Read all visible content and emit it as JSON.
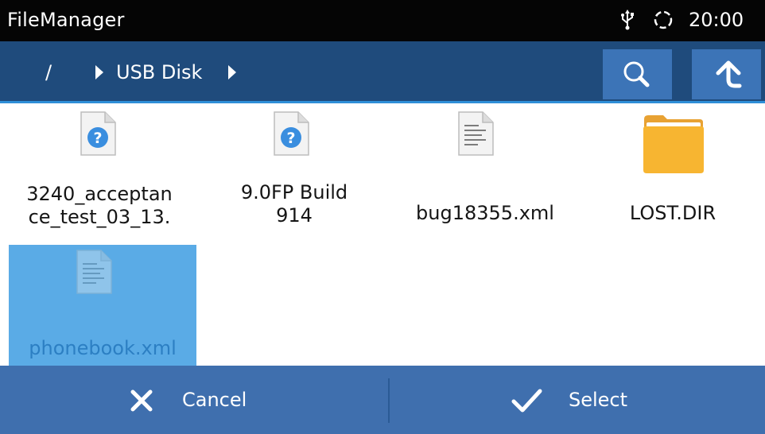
{
  "status_bar": {
    "app_title": "FileManager",
    "usb_icon": "usb-icon",
    "sync_icon": "sync-icon",
    "time": "20:00"
  },
  "path_bar": {
    "breadcrumbs": [
      "/",
      "USB Disk"
    ],
    "search_icon": "search-icon",
    "up_icon": "up-arrow-icon",
    "background_color": "#1f4b7c",
    "button_color": "#3c74b7"
  },
  "files": [
    {
      "name_line1": "3240_acceptan",
      "name_line2": "ce_test_03_13.",
      "icon": "unknown-file-icon",
      "selected": false
    },
    {
      "name_line1": "9.0FP Build",
      "name_line2": "914",
      "icon": "unknown-file-icon",
      "selected": false
    },
    {
      "name": "bug18355.xml",
      "icon": "text-file-icon",
      "selected": false
    },
    {
      "name": "LOST.DIR",
      "icon": "folder-icon",
      "selected": false
    },
    {
      "name": "phonebook.xml",
      "icon": "text-file-icon",
      "selected": true
    }
  ],
  "selection_color": "#5aabe6",
  "bottom_bar": {
    "cancel_label": "Cancel",
    "select_label": "Select",
    "background_color": "#3f6fae"
  }
}
